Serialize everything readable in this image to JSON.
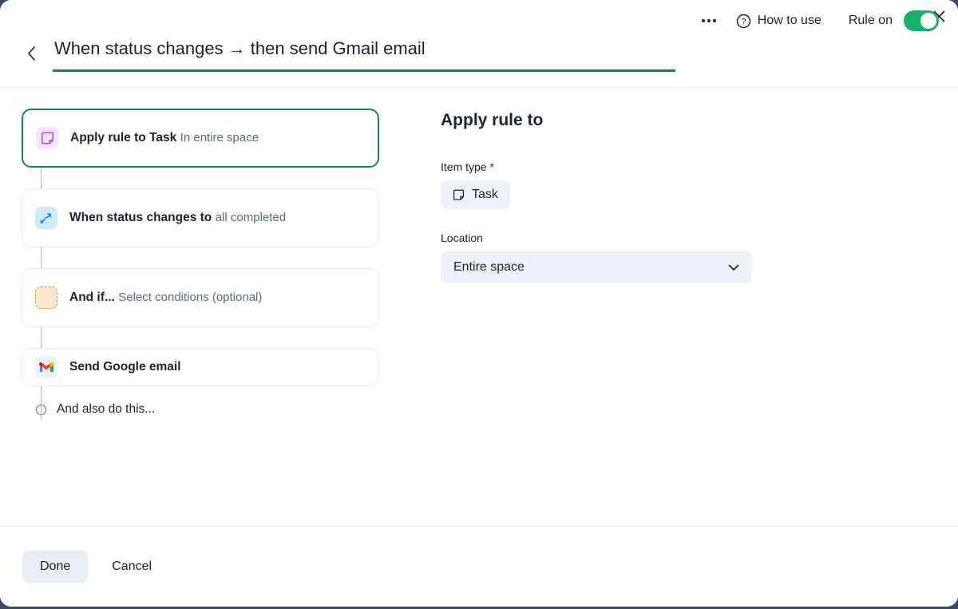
{
  "window": {
    "close_icon": "close-icon",
    "back_icon": "chevron-left-icon"
  },
  "header": {
    "title": "When status changes → then send Gmail email",
    "more_icon": "more-options-icon",
    "help_icon": "question-circle-icon",
    "help_label": "How to use",
    "toggle_label": "Rule on",
    "toggle_on": true,
    "accent_color": "#1a7f64",
    "toggle_color": "#17b26a"
  },
  "flow": {
    "cards": [
      {
        "title": "Apply rule to Task",
        "subtitle": "In entire space",
        "icon": "task-icon",
        "selected": true
      },
      {
        "title": "When status changes to",
        "subtitle": "all completed",
        "icon": "status-change-icon",
        "selected": false
      },
      {
        "title": "And if...",
        "subtitle": "Select conditions (optional)",
        "icon": "condition-placeholder-icon",
        "selected": false
      },
      {
        "title": "Send Google email",
        "subtitle": "",
        "icon": "gmail-icon",
        "selected": false
      }
    ],
    "add_step_label": "And also do this..."
  },
  "panel": {
    "title": "Apply rule to",
    "item_type_label": "Item type *",
    "item_type_value": "Task",
    "item_type_icon": "task-outline-icon",
    "location_label": "Location",
    "location_value": "Entire space",
    "chevron_icon": "chevron-down-icon"
  },
  "footer": {
    "done_label": "Done",
    "cancel_label": "Cancel"
  }
}
